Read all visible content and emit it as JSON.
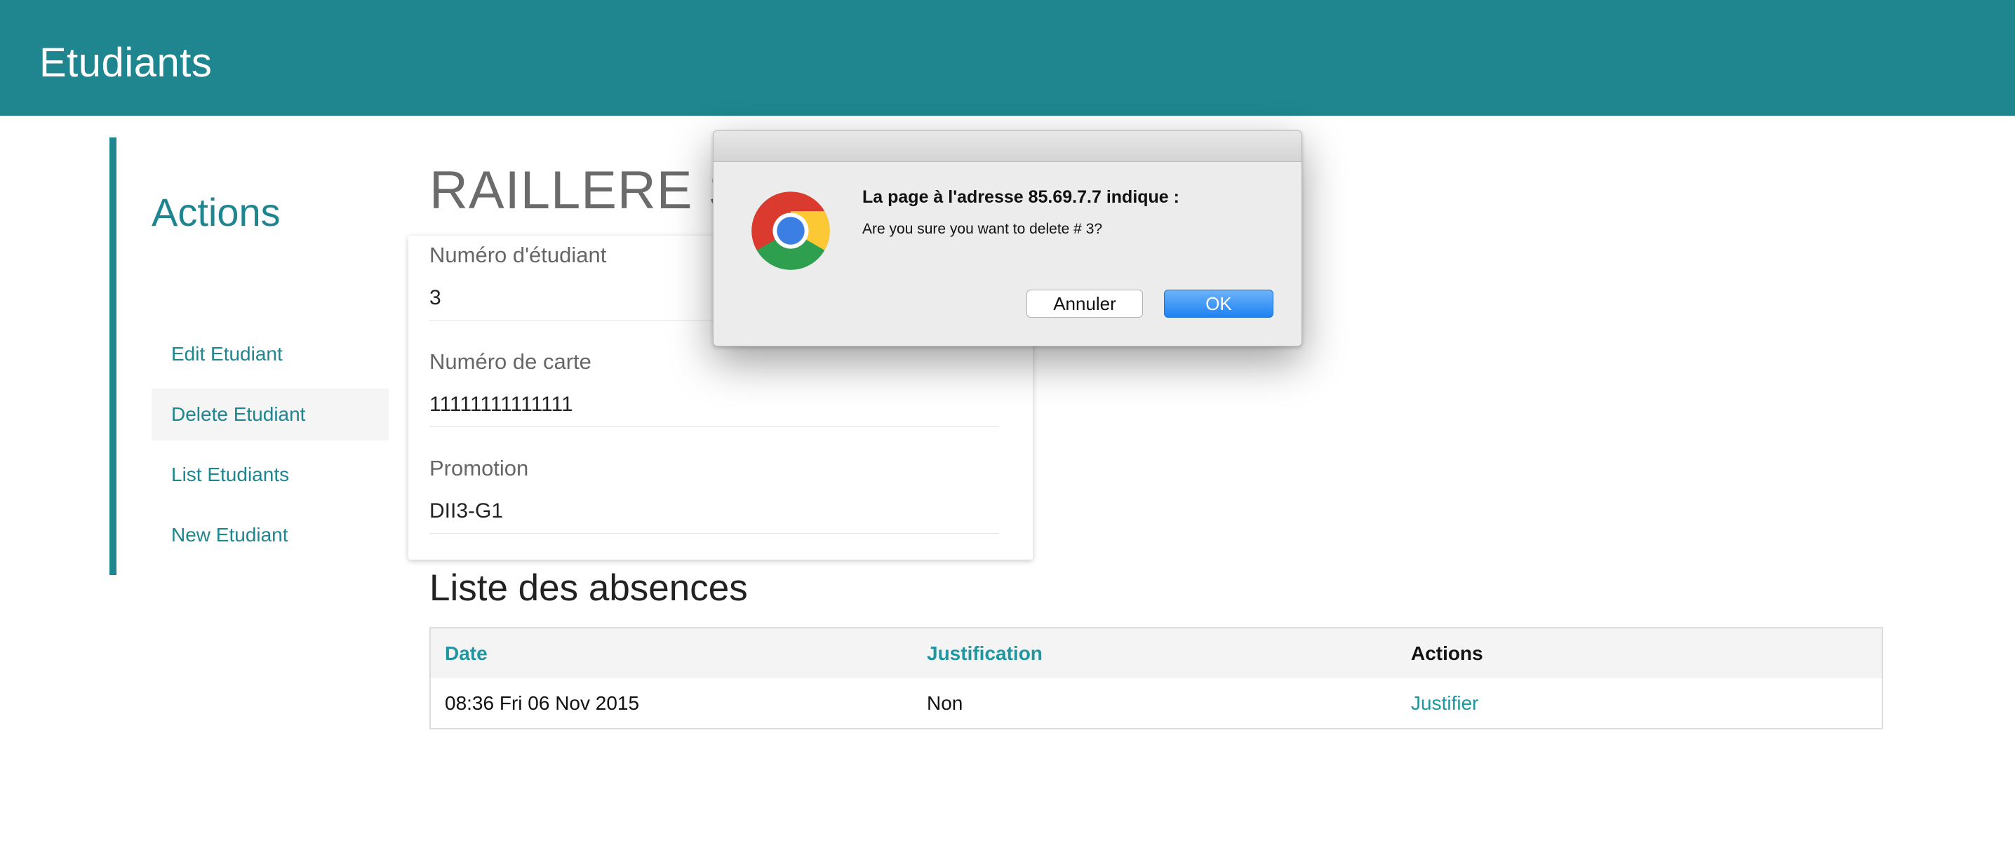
{
  "header": {
    "title": "Etudiants"
  },
  "sidebar": {
    "heading": "Actions",
    "items": [
      {
        "label": "Edit Etudiant"
      },
      {
        "label": "Delete Etudiant"
      },
      {
        "label": "List Etudiants"
      },
      {
        "label": "New Etudiant"
      }
    ]
  },
  "student": {
    "name": "RAILLERE S",
    "fields": [
      {
        "label": "Numéro d'étudiant",
        "value": "3"
      },
      {
        "label": "Numéro de carte",
        "value": "11111111111111"
      },
      {
        "label": "Promotion",
        "value": "DII3-G1"
      }
    ]
  },
  "absences": {
    "title": "Liste des absences",
    "columns": [
      "Date",
      "Justification",
      "Actions"
    ],
    "rows": [
      {
        "date": "08:36 Fri 06 Nov 2015",
        "justification": "Non",
        "action": "Justifier"
      }
    ]
  },
  "dialog": {
    "heading": "La page à l'adresse 85.69.7.7 indique :",
    "message": "Are you sure you want to delete # 3?",
    "cancel_label": "Annuler",
    "ok_label": "OK",
    "icon": "chrome-logo-icon"
  },
  "colors": {
    "accent": "#1f858f",
    "link": "#1f96a0",
    "ok_button": "#1e82f2"
  }
}
